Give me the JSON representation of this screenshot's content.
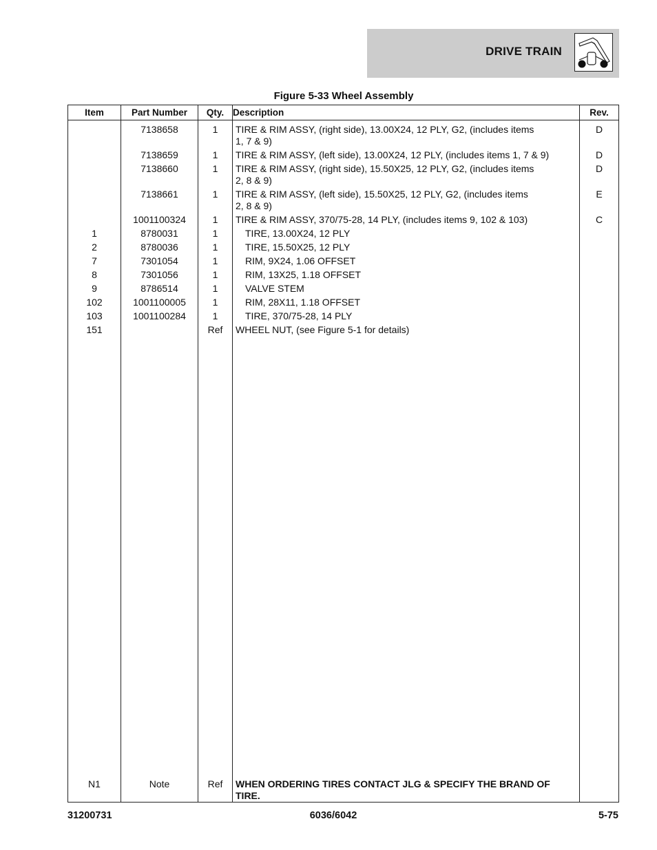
{
  "header": {
    "section_title": "DRIVE TRAIN",
    "icon": "telehandler-icon"
  },
  "figure_title": "Figure 5-33 Wheel Assembly",
  "table": {
    "columns": [
      "Item",
      "Part Number",
      "Qty.",
      "Description",
      "Rev."
    ],
    "rows": [
      {
        "item": "",
        "part": "7138658",
        "qty": "1",
        "desc": "TIRE & RIM ASSY, (right side), 13.00X24, 12 PLY, G2, (includes items",
        "desc2": "1, 7 & 9)",
        "rev": "D",
        "indent": false
      },
      {
        "item": "",
        "part": "7138659",
        "qty": "1",
        "desc": "TIRE & RIM ASSY, (left side), 13.00X24, 12 PLY, (includes items 1, 7 & 9)",
        "desc2": "",
        "rev": "D",
        "indent": false
      },
      {
        "item": "",
        "part": "7138660",
        "qty": "1",
        "desc": "TIRE & RIM ASSY, (right side), 15.50X25, 12 PLY, G2, (includes items",
        "desc2": "2, 8 & 9)",
        "rev": "D",
        "indent": false
      },
      {
        "item": "",
        "part": "7138661",
        "qty": "1",
        "desc": "TIRE & RIM ASSY, (left side), 15.50X25, 12 PLY, G2, (includes items",
        "desc2": "2, 8 & 9)",
        "rev": "E",
        "indent": false
      },
      {
        "item": "",
        "part": "1001100324",
        "qty": "1",
        "desc": "TIRE & RIM ASSY, 370/75-28, 14 PLY, (includes items 9, 102 & 103)",
        "desc2": "",
        "rev": "C",
        "indent": false
      },
      {
        "item": "1",
        "part": "8780031",
        "qty": "1",
        "desc": "TIRE, 13.00X24, 12 PLY",
        "desc2": "",
        "rev": "",
        "indent": true
      },
      {
        "item": "2",
        "part": "8780036",
        "qty": "1",
        "desc": "TIRE, 15.50X25, 12 PLY",
        "desc2": "",
        "rev": "",
        "indent": true
      },
      {
        "item": "7",
        "part": "7301054",
        "qty": "1",
        "desc": "RIM, 9X24, 1.06 OFFSET",
        "desc2": "",
        "rev": "",
        "indent": true
      },
      {
        "item": "8",
        "part": "7301056",
        "qty": "1",
        "desc": "RIM, 13X25, 1.18 OFFSET",
        "desc2": "",
        "rev": "",
        "indent": true
      },
      {
        "item": "9",
        "part": "8786514",
        "qty": "1",
        "desc": "VALVE STEM",
        "desc2": "",
        "rev": "",
        "indent": true
      },
      {
        "item": "102",
        "part": "1001100005",
        "qty": "1",
        "desc": "RIM, 28X11, 1.18 OFFSET",
        "desc2": "",
        "rev": "",
        "indent": true
      },
      {
        "item": "103",
        "part": "1001100284",
        "qty": "1",
        "desc": "TIRE, 370/75-28, 14 PLY",
        "desc2": "",
        "rev": "",
        "indent": true
      },
      {
        "item": "151",
        "part": "",
        "qty": "Ref",
        "desc": "WHEEL NUT, (see Figure 5-1 for details)",
        "desc2": "",
        "rev": "",
        "indent": false
      }
    ],
    "note": {
      "item": "N1",
      "part": "Note",
      "qty": "Ref",
      "desc": "WHEN ORDERING TIRES CONTACT JLG & SPECIFY THE BRAND OF TIRE.",
      "rev": ""
    }
  },
  "footer": {
    "doc_number": "31200731",
    "model": "6036/6042",
    "page": "5-75"
  }
}
